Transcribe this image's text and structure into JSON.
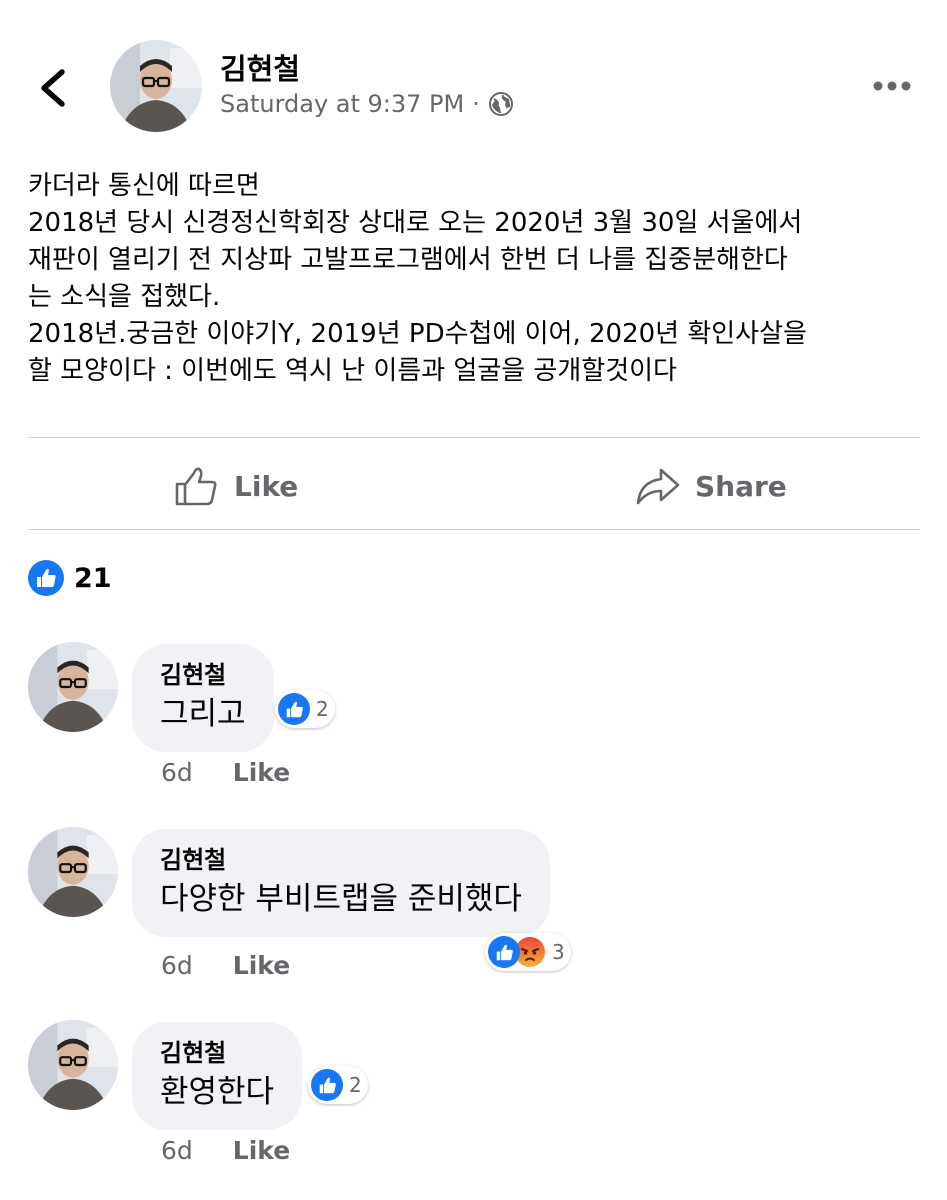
{
  "header": {
    "author": "김현철",
    "timestamp": "Saturday at 9:37 PM",
    "separator": "·",
    "privacy_icon": "globe-icon",
    "back_icon": "chevron-left-icon",
    "more_icon": "more-horizontal-icon"
  },
  "post": {
    "lines": [
      "카더라 통신에 따르면",
      "2018년 당시 신경정신학회장 상대로 오는 2020년 3월 30일 서울에서",
      "재판이 열리기 전 지상파 고발프로그램에서 한번 더 나를 집중분해한다",
      "는 소식을 접했다.",
      "2018년.궁금한 이야기Y, 2019년 PD수첩에 이어, 2020년 확인사살을",
      "할 모양이다 : 이번에도 역시 난 이름과 얼굴을 공개할것이다"
    ]
  },
  "actions": {
    "like_label": "Like",
    "share_label": "Share"
  },
  "reactions": {
    "count": "21"
  },
  "comments": [
    {
      "author": "김현철",
      "text": "그리고",
      "reaction_count": "2",
      "time": "6d",
      "like_label": "Like"
    },
    {
      "author": "김현철",
      "text": "다양한 부비트랩을 준비했다",
      "reaction_count": "3",
      "time": "6d",
      "like_label": "Like"
    },
    {
      "author": "김현철",
      "text": "환영한다",
      "reaction_count": "2",
      "time": "6d",
      "like_label": "Like"
    }
  ],
  "colors": {
    "accent": "#1877f2",
    "secondary_text": "#65676b",
    "bubble": "#f0f2f5",
    "divider": "#ced0d4"
  }
}
